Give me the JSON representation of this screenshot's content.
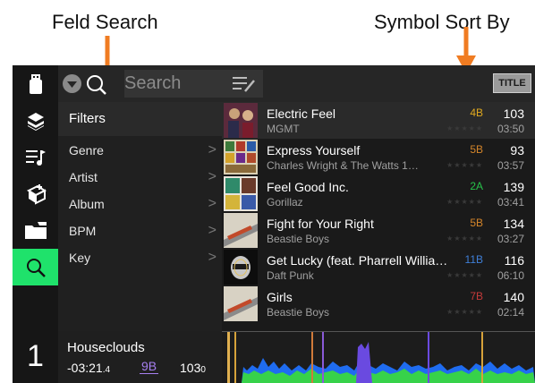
{
  "annotations": {
    "left_label": "Feld Search",
    "right_label": "Symbol Sort By"
  },
  "search": {
    "placeholder": "Search"
  },
  "sort_badge": "TITLE",
  "sidebar": {
    "icons": [
      "usb-drive-icon",
      "crates-icon",
      "playlist-icon",
      "prepare-icon",
      "folder-icon",
      "search-icon"
    ],
    "active": "search-icon",
    "deck_number": "1"
  },
  "filters": {
    "header": "Filters",
    "items": [
      {
        "label": "Genre"
      },
      {
        "label": "Artist"
      },
      {
        "label": "Album"
      },
      {
        "label": "BPM"
      },
      {
        "label": "Key"
      }
    ]
  },
  "tracks": [
    {
      "title": "Electric Feel",
      "artist": "MGMT",
      "key": "4B",
      "key_color": "#e0a91f",
      "bpm": "103",
      "time": "03:50"
    },
    {
      "title": "Express Yourself",
      "artist": "Charles Wright & The Watts 1…",
      "key": "5B",
      "key_color": "#d4852a",
      "bpm": "93",
      "time": "03:57"
    },
    {
      "title": "Feel Good Inc.",
      "artist": "Gorillaz",
      "key": "2A",
      "key_color": "#27c24a",
      "bpm": "139",
      "time": "03:41"
    },
    {
      "title": "Fight for Your Right",
      "artist": "Beastie Boys",
      "key": "5B",
      "key_color": "#d4852a",
      "bpm": "134",
      "time": "03:27"
    },
    {
      "title": "Get Lucky (feat. Pharrell Willia…",
      "artist": "Daft Punk",
      "key": "11B",
      "key_color": "#3f7fd8",
      "bpm": "116",
      "time": "06:10"
    },
    {
      "title": "Girls",
      "artist": "Beastie Boys",
      "key": "7B",
      "key_color": "#c63a3a",
      "bpm": "140",
      "time": "02:14"
    }
  ],
  "now_playing": {
    "title": "Houseclouds",
    "time_main": "-03:21",
    "time_tenth": ".4",
    "key": "9B",
    "bpm_main": "103",
    "bpm_decimal": "0"
  },
  "colors": {
    "accent": "#1fe26b",
    "background": "#1a1a1a",
    "key_purple": "#a67ff0"
  }
}
